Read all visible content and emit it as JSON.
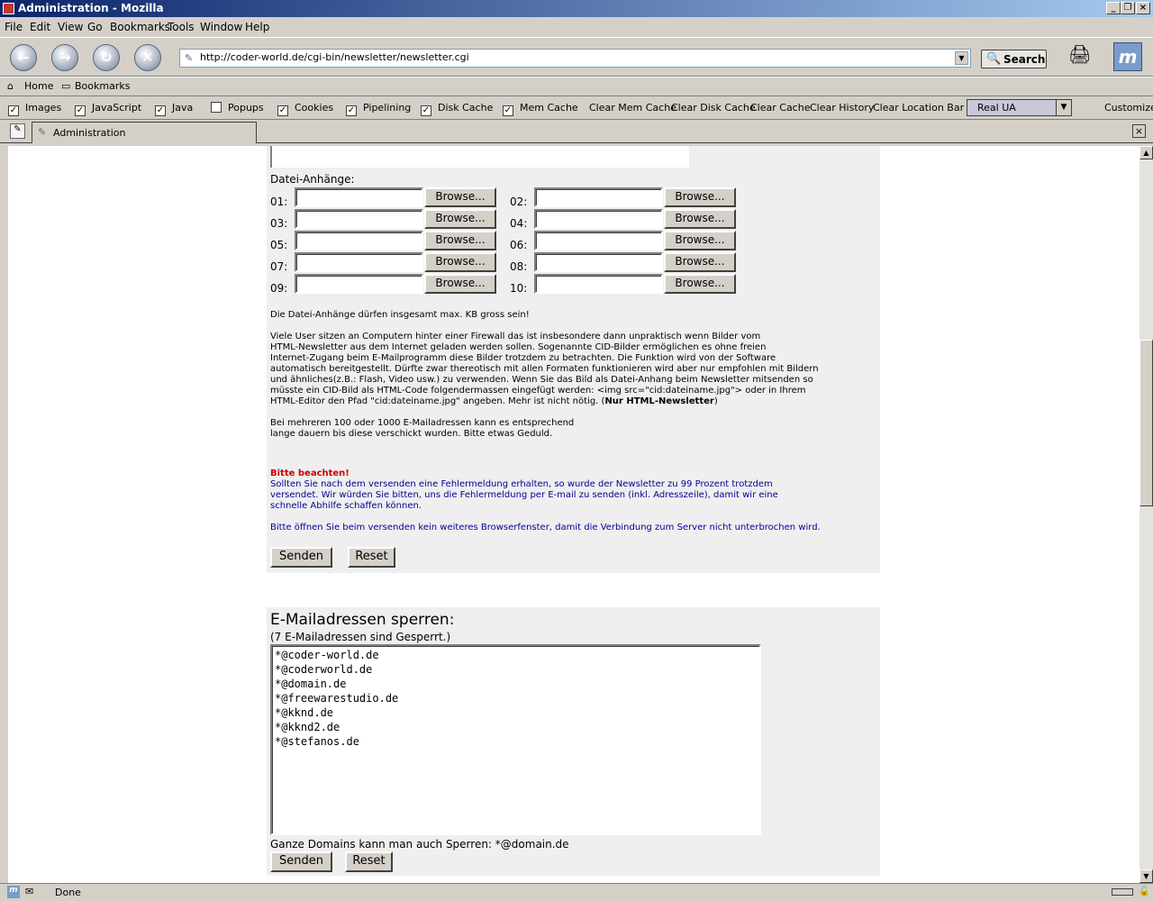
{
  "window": {
    "title": "Administration - Mozilla"
  },
  "menu": [
    "File",
    "Edit",
    "View",
    "Go",
    "Bookmarks",
    "Tools",
    "Window",
    "Help"
  ],
  "nav": {
    "url": "http://coder-world.de/cgi-bin/newsletter/newsletter.cgi",
    "search_label": "Search"
  },
  "bookmarks": {
    "home": "Home",
    "bookmarks": "Bookmarks"
  },
  "prefbar": {
    "checks": [
      {
        "label": "Images",
        "checked": true
      },
      {
        "label": "JavaScript",
        "checked": true
      },
      {
        "label": "Java",
        "checked": true
      },
      {
        "label": "Popups",
        "checked": false
      },
      {
        "label": "Cookies",
        "checked": true
      },
      {
        "label": "Pipelining",
        "checked": true
      },
      {
        "label": "Disk Cache",
        "checked": true
      },
      {
        "label": "Mem Cache",
        "checked": true
      }
    ],
    "buttons": [
      "Clear Mem Cache",
      "Clear Disk Cache",
      "Clear Cache",
      "Clear History",
      "Clear Location Bar"
    ],
    "ua": "Real UA",
    "customize": "Customize"
  },
  "tab": {
    "title": "Administration"
  },
  "attachments": {
    "heading": "Datei-Anhänge:",
    "browse": "Browse...",
    "slots": [
      "01:",
      "02:",
      "03:",
      "04:",
      "05:",
      "06:",
      "07:",
      "08:",
      "09:",
      "10:"
    ]
  },
  "info": {
    "maxsize": "Die Datei-Anhänge dürfen insgesamt max. KB gross sein!",
    "cid_text": "Viele User sitzen an Computern hinter einer Firewall das ist insbesondere dann unpraktisch wenn Bilder vom\nHTML-Newsletter aus dem Internet geladen werden sollen. Sogenannte CID-Bilder ermöglichen es ohne freien\nInternet-Zugang beim E-Mailprogramm diese Bilder trotzdem zu betrachten. Die Funktion wird von der Software\nautomatisch bereitgestellt. Dürfte zwar thereotisch mit allen Formaten funktionieren wird aber nur empfohlen mit Bildern\nund ähnliches(z.B.: Flash, Video usw.) zu verwenden. Wenn Sie das Bild als Datei-Anhang beim Newsletter mitsenden so\nmüsste ein CID-Bild als HTML-Code folgendermassen eingefügt werden: <img src=\"cid:dateiname.jpg\"> oder in Ihrem\nHTML-Editor den Pfad \"cid:dateiname.jpg\" angeben. Mehr ist nicht nötig. (",
    "cid_bold": "Nur HTML-Newsletter",
    "cid_close": ")",
    "wait_text": "Bei mehreren 100 oder 1000 E-Mailadressen kann es entsprechend\nlange dauern bis diese verschickt wurden. Bitte etwas Geduld.",
    "attention": "Bitte beachten!",
    "error_text": "Sollten Sie nach dem versenden eine Fehlermeldung erhalten, so wurde der Newsletter zu 99 Prozent trotzdem\nversendet. Wir würden Sie bitten, uns die Fehlermeldung per E-mail zu senden (inkl. Adresszeile), damit wir eine\nschnelle Abhilfe schaffen können.",
    "window_text": "Bitte öffnen Sie beim versenden kein weiteres Browserfenster, damit die Verbindung zum Server nicht unterbrochen wird."
  },
  "form1": {
    "send": "Senden",
    "reset": "Reset"
  },
  "block": {
    "heading": "E-Mailadressen sperren:",
    "count": "(7 E-Mailadressen sind Gesperrt.)",
    "addresses": "*@coder-world.de\n*@coderworld.de\n*@domain.de\n*@freewarestudio.de\n*@kknd.de\n*@kknd2.de\n*@stefanos.de",
    "hint": "Ganze Domains kann man auch Sperren:  *@domain.de",
    "send": "Senden",
    "reset": "Reset"
  },
  "status": {
    "text": "Done"
  }
}
